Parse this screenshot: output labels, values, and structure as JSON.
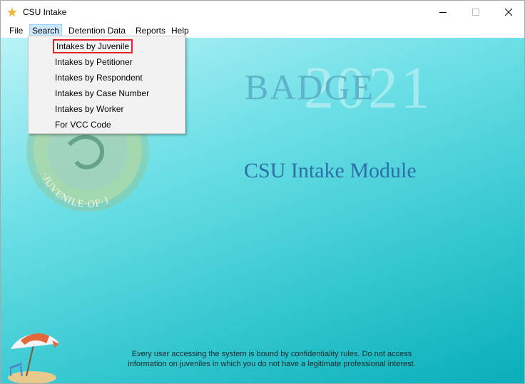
{
  "window": {
    "title": "CSU Intake",
    "app_icon": "star-icon"
  },
  "window_controls": {
    "minimize": "minimize-icon",
    "maximize": "maximize-icon",
    "close": "close-icon"
  },
  "menubar": {
    "items": [
      {
        "label": "File"
      },
      {
        "label": "Search"
      },
      {
        "label": "Detention Data"
      },
      {
        "label": "Reports"
      },
      {
        "label": "Help"
      }
    ]
  },
  "search_menu": {
    "items": [
      {
        "label": "Intakes by Juvenile"
      },
      {
        "label": "Intakes by Petitioner"
      },
      {
        "label": "Intakes by Respondent"
      },
      {
        "label": "Intakes by Case Number"
      },
      {
        "label": "Intakes by Worker"
      },
      {
        "label": "For VCC Code"
      }
    ]
  },
  "banner": {
    "badge": "BADGE",
    "year": "2021",
    "module": "CSU Intake Module"
  },
  "seal": {
    "text": "·JUVENILE·OF·J"
  },
  "footer": {
    "line1": "Every user accessing the system is bound by confidentiality rules. Do not access",
    "line2": "information on juveniles in which you do not have a legitimate professional interest."
  },
  "colors": {
    "accent": "#cce8ff",
    "highlight": "#e0262b",
    "background": "#33c6cf"
  }
}
